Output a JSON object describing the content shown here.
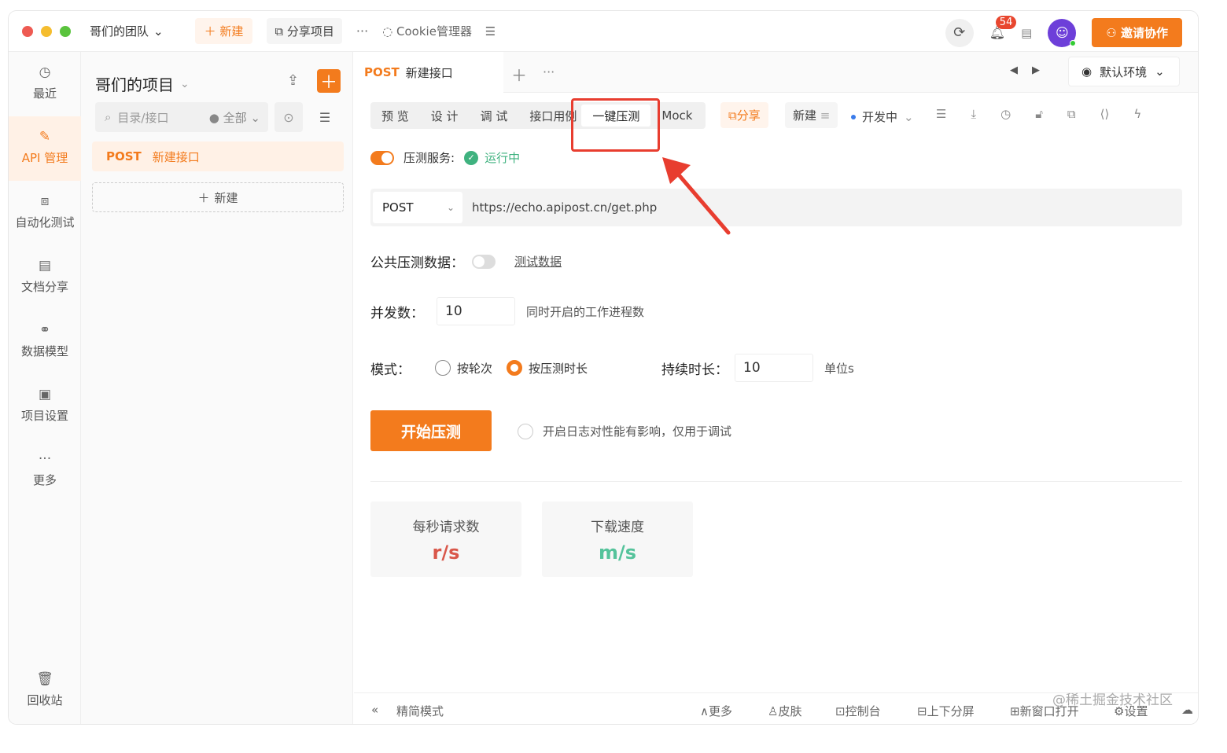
{
  "titlebar": {
    "team": "哥们的团队",
    "new_label": "＋ 新建",
    "share_project": "分享项目",
    "more": "···",
    "cookie": "Cookie管理器",
    "notif_count": "54",
    "invite": "邀请协作"
  },
  "nav": [
    {
      "label": "最近",
      "icon": "clock-icon"
    },
    {
      "label": "API 管理",
      "icon": "edit-icon"
    },
    {
      "label": "自动化测试",
      "icon": "flow-icon"
    },
    {
      "label": "文档分享",
      "icon": "doc-icon"
    },
    {
      "label": "数据模型",
      "icon": "model-icon"
    },
    {
      "label": "项目设置",
      "icon": "settings-doc-icon"
    },
    {
      "label": "更多",
      "icon": "more-icon"
    },
    {
      "label": "回收站",
      "icon": "trash-icon"
    }
  ],
  "tree": {
    "project_title": "哥们的项目",
    "search_placeholder": "目录/接口",
    "filter": "全部",
    "item_method": "POST",
    "item_name": "新建接口",
    "new_label": "新建"
  },
  "tab": {
    "method": "POST",
    "name": "新建接口",
    "env": "默认环境"
  },
  "subtabs": [
    "预 览",
    "设 计",
    "调 试",
    "接口用例",
    "一键压测",
    "Mock"
  ],
  "toolbar": {
    "share": "分享",
    "new": "新建",
    "status": "开发中"
  },
  "stress": {
    "service_label": "压测服务:",
    "service_status": "运行中",
    "method": "POST",
    "url": "https://echo.apipost.cn/get.php",
    "public_data_label": "公共压测数据：",
    "test_data_link": "测试数据",
    "concurrency_label": "并发数：",
    "concurrency_value": "10",
    "concurrency_hint": "同时开启的工作进程数",
    "mode_label": "模式：",
    "mode_by_rounds": "按轮次",
    "mode_by_duration": "按压测时长",
    "duration_label": "持续时长：",
    "duration_value": "10",
    "duration_unit": "单位s",
    "start_button": "开始压测",
    "log_option": "开启日志对性能有影响，仅用于调试"
  },
  "cards": [
    {
      "title": "每秒请求数",
      "value": "r/s",
      "color": "#d9574a"
    },
    {
      "title": "下载速度",
      "value": "m/s",
      "color": "#55c39b"
    }
  ],
  "statusbar": {
    "simple_mode": "精简模式",
    "more": "更多",
    "skin": "皮肤",
    "console": "控制台",
    "split": "上下分屏",
    "new_window": "新窗口打开",
    "settings": "设置",
    "watermark": "@稀土掘金技术社区"
  },
  "colors": {
    "accent": "#f37b1d",
    "highlight": "#e83d2f"
  }
}
